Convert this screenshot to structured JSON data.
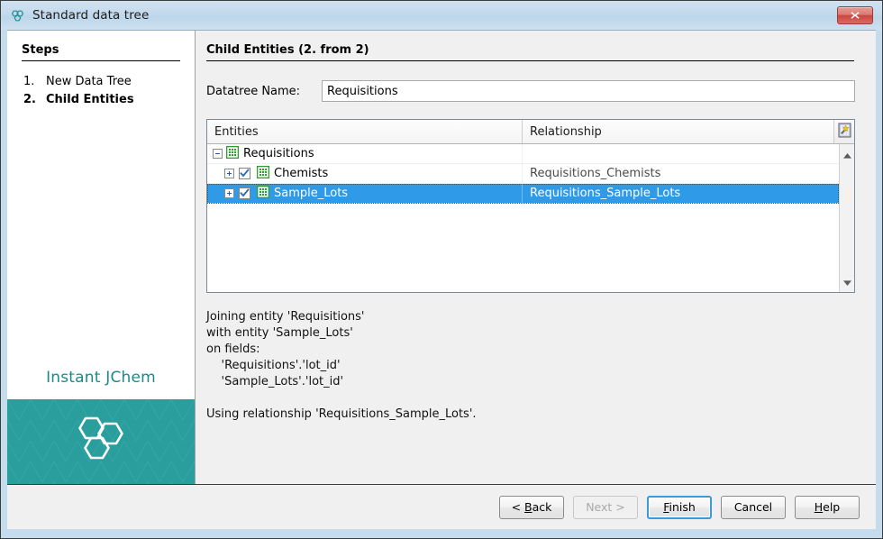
{
  "window": {
    "title": "Standard data tree",
    "title_icon": "molecule-icon",
    "close_label": "Close"
  },
  "sidebar": {
    "heading": "Steps",
    "steps": [
      {
        "num": "1.",
        "label": "New Data Tree",
        "current": false
      },
      {
        "num": "2.",
        "label": "Child Entities",
        "current": true
      }
    ],
    "brand": {
      "name": "Instant JChem",
      "logo_icon": "hexagon-molecule-logo"
    }
  },
  "main": {
    "panel_title": "Child Entities (2. from 2)",
    "name_field": {
      "label": "Datatree Name:",
      "value": "Requisitions",
      "placeholder": ""
    },
    "table": {
      "columns": {
        "entities": "Entities",
        "relationship": "Relationship"
      },
      "column_chooser_icon": "column-chooser-icon",
      "rows": [
        {
          "level": 0,
          "toggle": "minus",
          "has_checkbox": false,
          "checked": false,
          "entity": "Requisitions",
          "relationship": "",
          "selected": false
        },
        {
          "level": 1,
          "toggle": "plus",
          "has_checkbox": true,
          "checked": true,
          "entity": "Chemists",
          "relationship": "Requisitions_Chemists",
          "selected": false
        },
        {
          "level": 1,
          "toggle": "plus",
          "has_checkbox": true,
          "checked": true,
          "entity": "Sample_Lots",
          "relationship": "Requisitions_Sample_Lots",
          "selected": true
        }
      ],
      "scrollbar": {
        "up_icon": "scroll-up-arrow-icon",
        "down_icon": "scroll-down-arrow-icon"
      }
    },
    "description": "Joining entity 'Requisitions'\nwith entity 'Sample_Lots'\non fields:\n    'Requisitions'.'lot_id'\n    'Sample_Lots'.'lot_id'\n\nUsing relationship 'Requisitions_Sample_Lots'."
  },
  "footer": {
    "buttons": [
      {
        "id": "back",
        "label": "< Back",
        "mnemonic": "B",
        "state": "normal"
      },
      {
        "id": "next",
        "label": "Next >",
        "mnemonic": "",
        "state": "disabled"
      },
      {
        "id": "finish",
        "label": "Finish",
        "mnemonic": "F",
        "state": "focused"
      },
      {
        "id": "cancel",
        "label": "Cancel",
        "mnemonic": "",
        "state": "normal"
      },
      {
        "id": "help",
        "label": "Help",
        "mnemonic": "H",
        "state": "normal"
      }
    ]
  },
  "colors": {
    "titlebar": "#c3d9ec",
    "frame": "#c5dcee",
    "selection": "#2f9ae8",
    "brand_teal": "#2a9d9d",
    "brand_text": "#1a8a8a",
    "entity_icon_green": "#2f9e2f",
    "close_red": "#c9483f"
  }
}
